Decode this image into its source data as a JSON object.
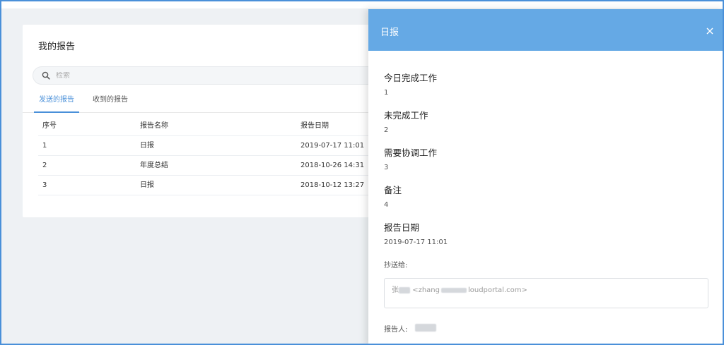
{
  "report_list": {
    "title": "我的报告",
    "search": {
      "placeholder": "检索"
    },
    "tabs": [
      {
        "label": "发送的报告",
        "active": true
      },
      {
        "label": "收到的报告",
        "active": false
      }
    ],
    "columns": [
      "序号",
      "报告名称",
      "报告日期"
    ],
    "rows": [
      {
        "index": "1",
        "name": "日报",
        "date": "2019-07-17 11:01"
      },
      {
        "index": "2",
        "name": "年度总结",
        "date": "2018-10-26 14:31"
      },
      {
        "index": "3",
        "name": "日报",
        "date": "2018-10-12 13:27"
      }
    ]
  },
  "drawer": {
    "title": "日报",
    "close_icon": "close-icon",
    "fields": [
      {
        "label": "今日完成工作",
        "value": "1"
      },
      {
        "label": "未完成工作",
        "value": "2"
      },
      {
        "label": "需要协调工作",
        "value": "3"
      },
      {
        "label": "备注",
        "value": "4"
      },
      {
        "label": "报告日期",
        "value": "2019-07-17 11:01"
      }
    ],
    "cc_label": "抄送给:",
    "cc_prefix": "张",
    "cc_mid": "<zhang",
    "cc_suffix": "loudportal.com>",
    "reporter_label": "报告人:"
  },
  "colors": {
    "accent": "#4a90d9",
    "drawer_header": "#65a9e5",
    "page_background": "#eef1f4"
  }
}
